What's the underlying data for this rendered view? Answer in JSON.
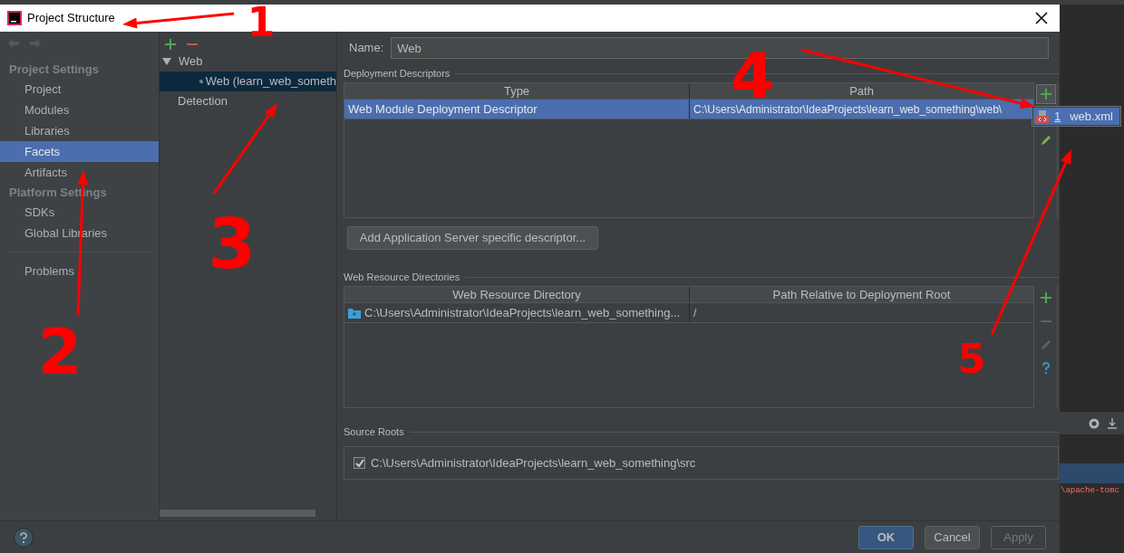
{
  "window": {
    "title": "Project Structure"
  },
  "sidebar": {
    "sections": [
      {
        "heading": "Project Settings",
        "items": [
          {
            "label": "Project",
            "selected": false
          },
          {
            "label": "Modules",
            "selected": false
          },
          {
            "label": "Libraries",
            "selected": false
          },
          {
            "label": "Facets",
            "selected": true
          },
          {
            "label": "Artifacts",
            "selected": false
          }
        ]
      },
      {
        "heading": "Platform Settings",
        "items": [
          {
            "label": "SDKs",
            "selected": false
          },
          {
            "label": "Global Libraries",
            "selected": false
          }
        ]
      }
    ],
    "footer_items": [
      {
        "label": "Problems",
        "selected": false
      }
    ]
  },
  "facets_tree": [
    {
      "label": "Web",
      "expanded": true,
      "selected": false,
      "children": [
        {
          "label": "Web (learn_web_someth",
          "selected": true
        }
      ]
    },
    {
      "label": "Detection",
      "selected": false
    }
  ],
  "name_field": {
    "label": "Name:",
    "value": "Web"
  },
  "deployment_descriptors": {
    "title": "Deployment Descriptors",
    "columns": [
      "Type",
      "Path"
    ],
    "rows": [
      {
        "cells": [
          "Web Module Deployment Descriptor",
          "C:\\Users\\Administrator\\IdeaProjects\\learn_web_something\\web\\"
        ],
        "selected": true
      }
    ],
    "tools": [
      {
        "kind": "add",
        "disabled": false
      },
      {
        "kind": "edit",
        "disabled": false
      }
    ],
    "add_menu": [
      {
        "index": "1",
        "label": "web.xml",
        "selected": true
      }
    ]
  },
  "add_server_descriptor_button": "Add Application Server specific descriptor...",
  "web_resource_directories": {
    "title": "Web Resource Directories",
    "columns": [
      "Web Resource Directory",
      "Path Relative to Deployment Root"
    ],
    "rows": [
      {
        "cells": [
          "C:\\Users\\Administrator\\IdeaProjects\\learn_web_something...",
          "/"
        ],
        "selected": false
      }
    ],
    "tools": [
      {
        "kind": "add",
        "disabled": false
      },
      {
        "kind": "remove",
        "disabled": true
      },
      {
        "kind": "edit",
        "disabled": true
      },
      {
        "kind": "help",
        "disabled": false
      }
    ]
  },
  "source_roots": {
    "title": "Source Roots",
    "items": [
      {
        "path": "C:\\Users\\Administrator\\IdeaProjects\\learn_web_something\\src",
        "checked": true
      }
    ]
  },
  "buttons": [
    {
      "label": "OK",
      "kind": "default",
      "disabled": false
    },
    {
      "label": "Cancel",
      "kind": "normal",
      "disabled": false
    },
    {
      "label": "Apply",
      "kind": "normal",
      "disabled": true
    }
  ],
  "background_ide": {
    "console_text": "\\apache-tomc"
  },
  "annotations": [
    {
      "label": "1"
    },
    {
      "label": "2"
    },
    {
      "label": "3"
    },
    {
      "label": "4"
    },
    {
      "label": "5"
    }
  ]
}
